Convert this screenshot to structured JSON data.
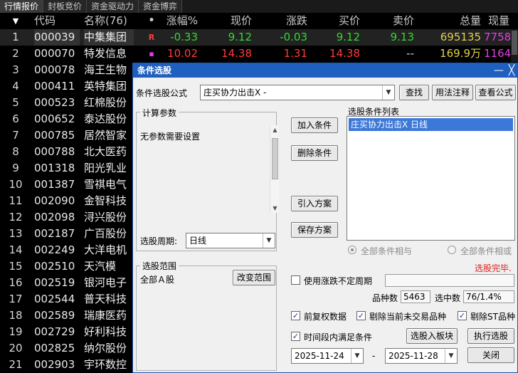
{
  "tabs": [
    "行情报价",
    "封板竞价",
    "资金驱动力",
    "资金博弈"
  ],
  "table": {
    "header": {
      "idx": "▼",
      "code": "代码",
      "name": "名称(76)",
      "dot": "•",
      "pct": "涨幅%",
      "price": "现价",
      "chg": "涨跌",
      "bid": "买价",
      "ask": "卖价",
      "vol": "总量",
      "cur": "现量"
    },
    "rows": [
      {
        "idx": "1",
        "code": "000039",
        "name": "中集集团",
        "flag": "R",
        "pct": "-0.33",
        "price": "9.12",
        "chg": "-0.03",
        "bid": "9.12",
        "ask": "9.13",
        "vol": "695135",
        "cur": "7758",
        "dir": "down"
      },
      {
        "idx": "2",
        "code": "000070",
        "name": "特发信息",
        "flag": "▪",
        "pct": "10.02",
        "price": "14.38",
        "chg": "1.31",
        "bid": "14.38",
        "ask": "--",
        "vol": "169.9万",
        "cur": "1164",
        "dir": "up"
      },
      {
        "idx": "3",
        "code": "000078",
        "name": "海王生物"
      },
      {
        "idx": "4",
        "code": "000411",
        "name": "英特集团"
      },
      {
        "idx": "5",
        "code": "000523",
        "name": "红棉股份"
      },
      {
        "idx": "6",
        "code": "000652",
        "name": "泰达股份"
      },
      {
        "idx": "7",
        "code": "000785",
        "name": "居然智家"
      },
      {
        "idx": "8",
        "code": "000788",
        "name": "北大医药"
      },
      {
        "idx": "9",
        "code": "001318",
        "name": "阳光乳业"
      },
      {
        "idx": "10",
        "code": "001387",
        "name": "雪祺电气"
      },
      {
        "idx": "11",
        "code": "002090",
        "name": "金智科技"
      },
      {
        "idx": "12",
        "code": "002098",
        "name": "浔兴股份"
      },
      {
        "idx": "13",
        "code": "002187",
        "name": "广百股份"
      },
      {
        "idx": "14",
        "code": "002249",
        "name": "大洋电机"
      },
      {
        "idx": "15",
        "code": "002510",
        "name": "天汽模"
      },
      {
        "idx": "16",
        "code": "002519",
        "name": "银河电子"
      },
      {
        "idx": "17",
        "code": "002544",
        "name": "普天科技"
      },
      {
        "idx": "18",
        "code": "002589",
        "name": "瑞康医药"
      },
      {
        "idx": "19",
        "code": "002729",
        "name": "好利科技"
      },
      {
        "idx": "20",
        "code": "002825",
        "name": "纳尔股份"
      },
      {
        "idx": "21",
        "code": "002903",
        "name": "宇环数控"
      }
    ]
  },
  "dialog": {
    "title": "条件选股",
    "formula_label": "条件选股公式",
    "formula_value": "庄买协力出击X  -",
    "find_btn": "查找",
    "usage_btn": "用法注释",
    "view_btn": "查看公式",
    "params_title": "计算参数",
    "params_text": "无参数需要设置",
    "add_btn": "加入条件",
    "delete_btn": "删除条件",
    "import_btn": "引入方案",
    "save_btn": "保存方案",
    "list_title": "选股条件列表",
    "list_item": "庄买协力出击X  日线",
    "period_label": "选股周期:",
    "period_value": "日线",
    "radio_and": "全部条件相与",
    "radio_or": "全部条件相或",
    "status": "选股完毕.",
    "range_title": "选股范围",
    "range_value": "全部Ａ股",
    "change_range_btn": "改变范围",
    "chk_volatile": "使用涨跌不定周期",
    "stock_count_label": "品种数",
    "stock_count": "5463",
    "selected_label": "选中数",
    "selected_value": "76/1.4%",
    "chk_fq": "前复权数据",
    "chk_remove_untraded": "剔除当前未交易品种",
    "chk_remove_st": "剔除ST品种",
    "chk_period": "时间段内满足条件",
    "to_block_btn": "选股入板块",
    "execute_btn": "执行选股",
    "date_from": "2025-11-24",
    "date_sep": "-",
    "date_to": "2025-11-28",
    "close_btn": "关闭",
    "colors": {
      "title_bg": "#1f5fbf",
      "list_sel": "#3c78d8",
      "status": "#e02020"
    }
  }
}
